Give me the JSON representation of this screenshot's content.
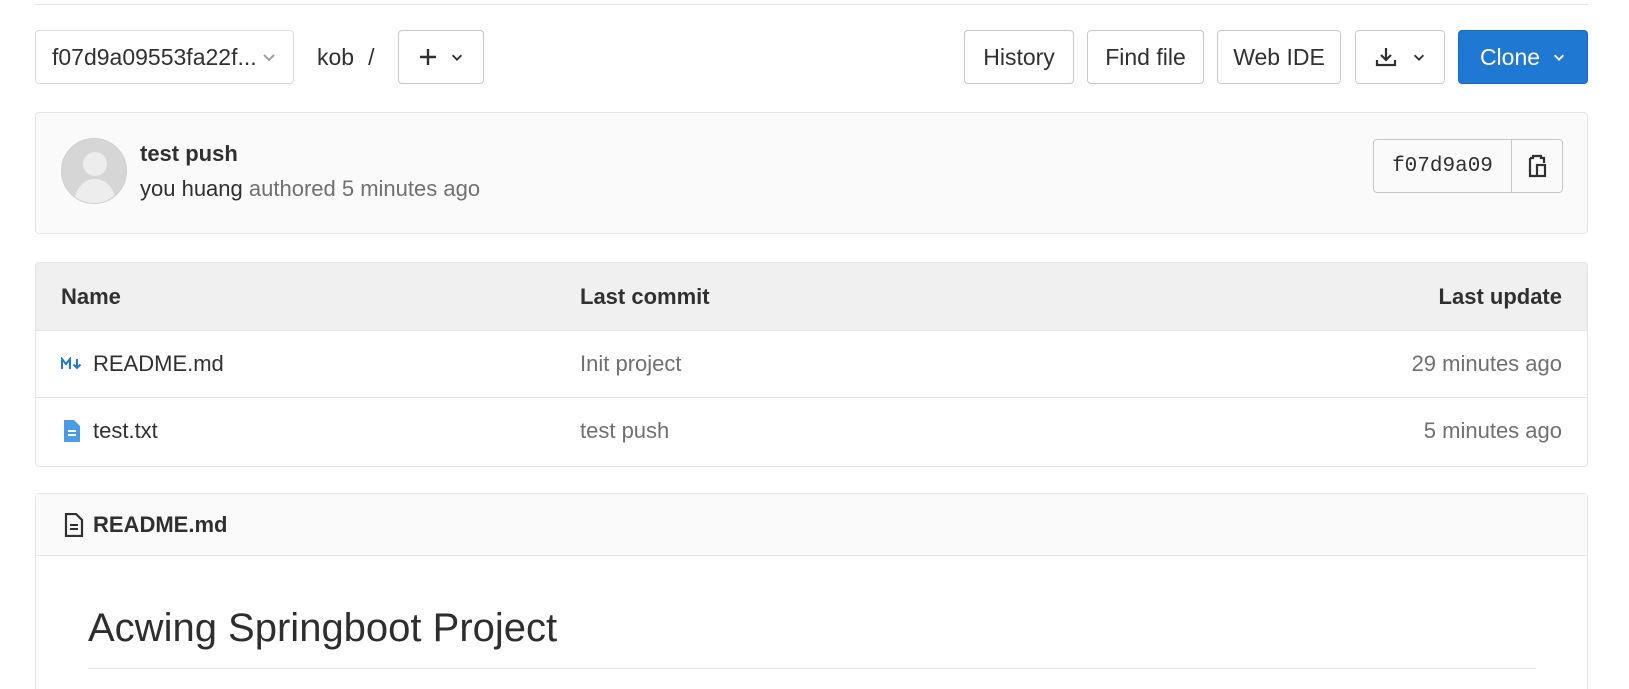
{
  "toolbar": {
    "ref_selector": "f07d9a09553fa22f...",
    "breadcrumb_project": "kob",
    "breadcrumb_separator": "/",
    "history_label": "History",
    "find_file_label": "Find file",
    "web_ide_label": "Web IDE",
    "clone_label": "Clone"
  },
  "commit": {
    "title": "test push",
    "author": "you huang",
    "authored_text": "authored 5 minutes ago",
    "short_sha": "f07d9a09"
  },
  "files": {
    "headers": {
      "name": "Name",
      "last_commit": "Last commit",
      "last_update": "Last update"
    },
    "rows": [
      {
        "name": "README.md",
        "icon": "markdown-icon",
        "last_commit": "Init project",
        "last_update": "29 minutes ago"
      },
      {
        "name": "test.txt",
        "icon": "file-text-icon",
        "last_commit": "test push",
        "last_update": "5 minutes ago"
      }
    ]
  },
  "readme": {
    "filename": "README.md",
    "heading": "Acwing Springboot Project"
  },
  "colors": {
    "primary": "#1f78d1",
    "markdown_icon": "#1f78d1",
    "text": "#303030",
    "muted": "#707070"
  }
}
